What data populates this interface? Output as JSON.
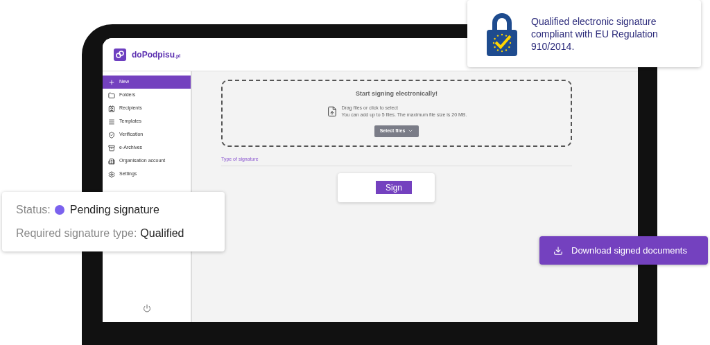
{
  "app": {
    "logo": {
      "name": "doPodpisu",
      "suffix": ".pl"
    }
  },
  "sidebar": {
    "items": [
      {
        "label": "New",
        "selected": true
      },
      {
        "label": "Folders",
        "selected": false
      },
      {
        "label": "Recipients",
        "selected": false
      },
      {
        "label": "Templates",
        "selected": false
      },
      {
        "label": "Verification",
        "selected": false
      },
      {
        "label": "e-Archives",
        "selected": false
      },
      {
        "label": "Organisation account",
        "selected": false
      },
      {
        "label": "Settings",
        "selected": false
      }
    ]
  },
  "upload": {
    "title": "Start signing electronically!",
    "hint": "Drag files or click to select",
    "limits": "You can add up to 5 files. The maximum file size is 20 MB.",
    "button": "Select files"
  },
  "signature_type": {
    "label": "Type of signature",
    "button": "Sign"
  },
  "eu_badge": {
    "text": "Qualified electronic signature compliant with EU Regulation 910/2014."
  },
  "status_card": {
    "status_label": "Status:",
    "status": "Pending signature",
    "color": "#7b62ee",
    "type_label": "Required signature type:",
    "type": "Qualified"
  },
  "download_button": "Download signed documents"
}
